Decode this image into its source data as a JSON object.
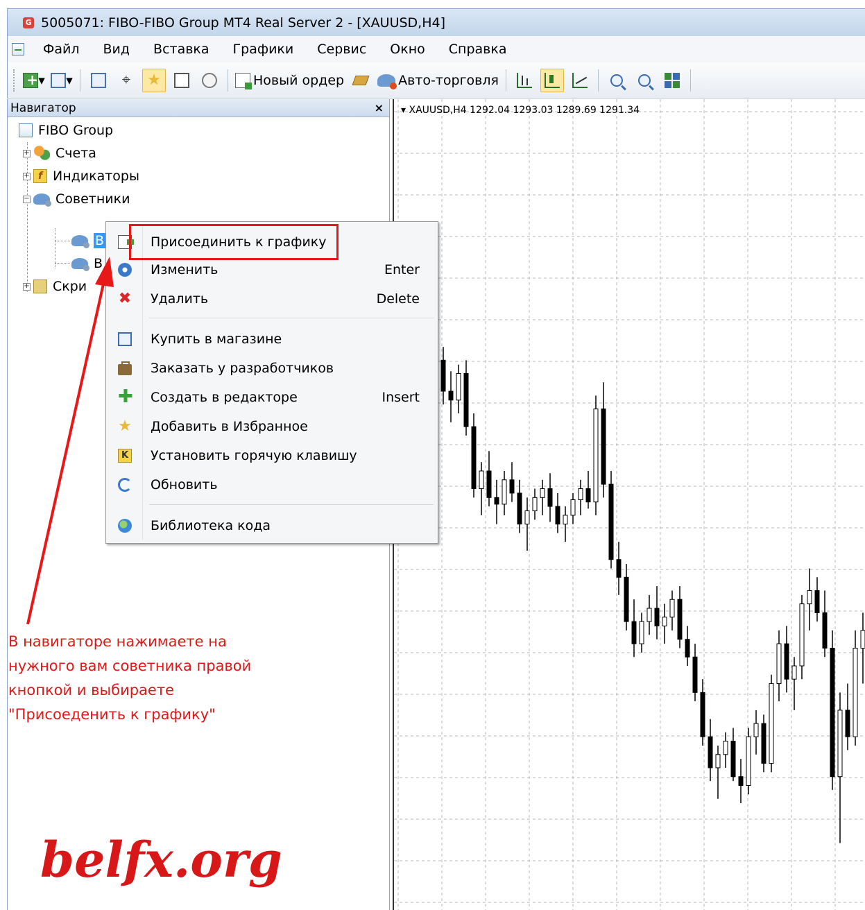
{
  "window": {
    "title": "5005071: FIBO-FIBO Group MT4 Real Server 2 - [XAUUSD,H4]",
    "app_icon_letter": "G"
  },
  "menu": {
    "items": [
      "Файл",
      "Вид",
      "Вставка",
      "Графики",
      "Сервис",
      "Окно",
      "Справка"
    ]
  },
  "toolbar": {
    "new_order_label": "Новый ордер",
    "auto_trading_label": "Авто-торговля"
  },
  "navigator": {
    "title": "Навигатор",
    "close_glyph": "×",
    "root": "FIBO Group",
    "nodes": {
      "accounts": "Счета",
      "indicators": "Индикаторы",
      "experts": "Советники",
      "expert_1": "B",
      "expert_2": "B",
      "scripts": "Скри"
    }
  },
  "chart": {
    "header": "XAUUSD,H4  1292.04 1293.03 1289.69 1291.34"
  },
  "context_menu": {
    "items": [
      {
        "label": "Присоединить к графику",
        "shortcut": "",
        "icon": "attach-icon"
      },
      {
        "label": "Изменить",
        "shortcut": "Enter",
        "icon": "gear-icon"
      },
      {
        "label": "Удалить",
        "shortcut": "Delete",
        "icon": "delete-icon"
      },
      {
        "label": "Купить в магазине",
        "shortcut": "",
        "icon": "store-icon"
      },
      {
        "label": "Заказать у разработчиков",
        "shortcut": "",
        "icon": "briefcase-icon"
      },
      {
        "label": "Создать в редакторе",
        "shortcut": "Insert",
        "icon": "plus-icon"
      },
      {
        "label": "Добавить в Избранное",
        "shortcut": "",
        "icon": "favorites-icon"
      },
      {
        "label": "Установить горячую клавишу",
        "shortcut": "",
        "icon": "hotkey-icon"
      },
      {
        "label": "Обновить",
        "shortcut": "",
        "icon": "refresh-icon"
      },
      {
        "label": "Библиотека кода",
        "shortcut": "",
        "icon": "globe-icon"
      }
    ]
  },
  "annotation": {
    "line1": "В навигаторе нажимаете на",
    "line2": "нужного вам советника правой",
    "line3": "кнопкой и выбираете",
    "line4": "\"Присоеденить к графику\"",
    "color": "#e01818"
  },
  "brand": {
    "text": "belfx.org",
    "color": "#d81818"
  },
  "chart_data": {
    "type": "candlestick",
    "candles": [
      [
        1312.0,
        1316.5,
        1309.0,
        1311.0
      ],
      [
        1311.0,
        1314.0,
        1305.0,
        1306.5
      ],
      [
        1306.5,
        1311.0,
        1304.0,
        1309.5
      ],
      [
        1309.5,
        1316.0,
        1307.5,
        1314.0
      ],
      [
        1314.0,
        1317.5,
        1291.0,
        1293.0
      ],
      [
        1293.0,
        1296.0,
        1283.0,
        1286.0
      ],
      [
        1286.0,
        1290.5,
        1279.0,
        1284.0
      ],
      [
        1284.0,
        1292.0,
        1281.0,
        1290.0
      ],
      [
        1290.0,
        1293.0,
        1276.0,
        1278.0
      ],
      [
        1278.0,
        1281.0,
        1262.0,
        1264.0
      ],
      [
        1264.0,
        1270.0,
        1258.0,
        1268.0
      ],
      [
        1268.0,
        1272.5,
        1260.0,
        1262.0
      ],
      [
        1262.0,
        1266.0,
        1256.0,
        1260.5
      ],
      [
        1260.5,
        1268.0,
        1258.0,
        1266.0
      ],
      [
        1266.0,
        1270.0,
        1261.0,
        1263.0
      ],
      [
        1263.0,
        1266.0,
        1254.0,
        1256.0
      ],
      [
        1256.0,
        1262.0,
        1250.0,
        1259.0
      ],
      [
        1259.0,
        1264.0,
        1257.0,
        1262.0
      ],
      [
        1262.0,
        1266.0,
        1258.0,
        1264.0
      ],
      [
        1264.0,
        1267.5,
        1256.5,
        1260.0
      ],
      [
        1260.0,
        1263.0,
        1254.0,
        1256.0
      ],
      [
        1256.0,
        1260.0,
        1252.0,
        1258.0
      ],
      [
        1258.0,
        1263.0,
        1256.0,
        1261.5
      ],
      [
        1261.5,
        1266.0,
        1258.0,
        1264.0
      ],
      [
        1264.0,
        1268.0,
        1259.5,
        1261.0
      ],
      [
        1261.0,
        1285.0,
        1258.0,
        1282.0
      ],
      [
        1282.0,
        1288.0,
        1262.0,
        1265.0
      ],
      [
        1265.0,
        1268.0,
        1246.0,
        1248.0
      ],
      [
        1248.0,
        1252.0,
        1240.0,
        1244.0
      ],
      [
        1244.0,
        1247.0,
        1232.0,
        1234.0
      ],
      [
        1234.0,
        1239.0,
        1226.0,
        1229.0
      ],
      [
        1229.0,
        1236.0,
        1227.0,
        1234.0
      ],
      [
        1234.0,
        1240.0,
        1231.0,
        1237.0
      ],
      [
        1237.0,
        1242.0,
        1230.0,
        1233.0
      ],
      [
        1233.0,
        1238.0,
        1229.0,
        1235.0
      ],
      [
        1235.0,
        1241.0,
        1232.0,
        1239.0
      ],
      [
        1239.0,
        1242.0,
        1228.0,
        1230.0
      ],
      [
        1230.0,
        1233.0,
        1224.0,
        1226.0
      ],
      [
        1226.0,
        1229.0,
        1216.0,
        1218.0
      ],
      [
        1218.0,
        1221.0,
        1206.0,
        1208.0
      ],
      [
        1208.0,
        1212.0,
        1198.0,
        1201.0
      ],
      [
        1201.0,
        1206.0,
        1194.0,
        1204.0
      ],
      [
        1204.0,
        1209.0,
        1201.0,
        1207.0
      ],
      [
        1207.0,
        1210.0,
        1198.0,
        1199.0
      ],
      [
        1199.0,
        1203.0,
        1193.0,
        1197.0
      ],
      [
        1197.0,
        1210.0,
        1195.0,
        1208.0
      ],
      [
        1208.0,
        1214.0,
        1204.0,
        1211.0
      ],
      [
        1211.0,
        1213.0,
        1200.0,
        1202.0
      ],
      [
        1202.0,
        1222.0,
        1200.0,
        1220.0
      ],
      [
        1220.0,
        1232.0,
        1216.0,
        1229.0
      ],
      [
        1229.0,
        1233.0,
        1218.0,
        1221.0
      ],
      [
        1221.0,
        1226.0,
        1214.0,
        1224.0
      ],
      [
        1224.0,
        1240.0,
        1221.0,
        1238.0
      ],
      [
        1238.0,
        1246.0,
        1232.0,
        1241.0
      ],
      [
        1241.0,
        1244.0,
        1234.0,
        1236.0
      ],
      [
        1236.0,
        1241.0,
        1226.0,
        1228.0
      ],
      [
        1228.0,
        1232.0,
        1196.0,
        1199.0
      ],
      [
        1199.0,
        1218.0,
        1184.0,
        1214.0
      ],
      [
        1214.0,
        1220.0,
        1205.0,
        1208.0
      ],
      [
        1208.0,
        1232.0,
        1206.0,
        1228.0
      ],
      [
        1228.0,
        1236.0,
        1220.0,
        1232.0
      ]
    ]
  }
}
